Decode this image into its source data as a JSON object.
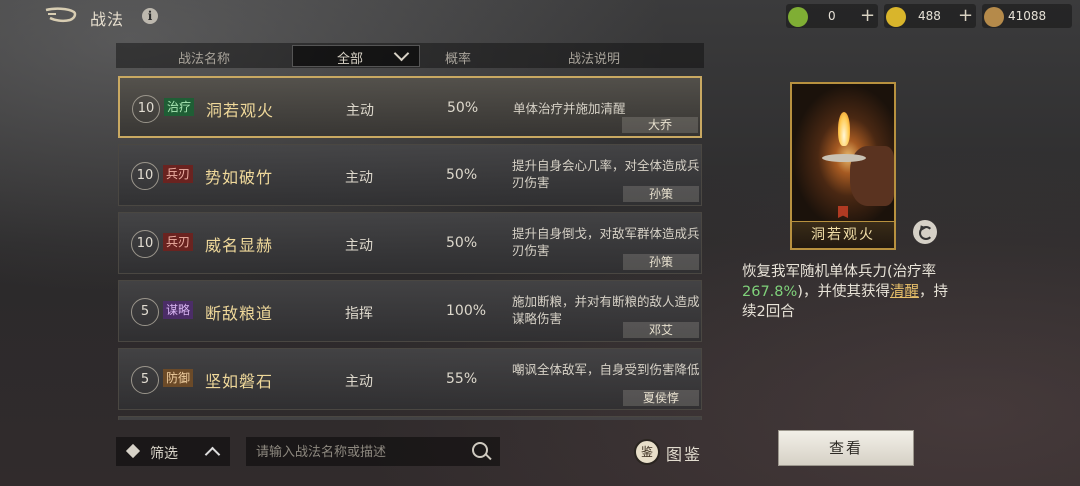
{
  "header": {
    "title": "战法",
    "currencies": [
      {
        "icon": "jade-icon",
        "value": "0",
        "color": "#7fae34"
      },
      {
        "icon": "gold-icon",
        "value": "488",
        "color": "#d9b52b"
      },
      {
        "icon": "copper-coin-icon",
        "value": "41088",
        "color": "#b58a4a"
      }
    ]
  },
  "table": {
    "col_name": "战法名称",
    "filter_value": "全部",
    "col_rate": "概率",
    "col_desc": "战法说明"
  },
  "skills": [
    {
      "level": "10",
      "tag": "治疗",
      "name": "洞若观火",
      "type": "主动",
      "rate": "50%",
      "desc": "单体治疗并施加清醒",
      "owner": "大乔"
    },
    {
      "level": "10",
      "tag": "兵刃",
      "name": "势如破竹",
      "type": "主动",
      "rate": "50%",
      "desc": "提升自身会心几率，对全体造成兵刃伤害",
      "owner": "孙策"
    },
    {
      "level": "10",
      "tag": "兵刃",
      "name": "威名显赫",
      "type": "主动",
      "rate": "50%",
      "desc": "提升自身倒戈，对敌军群体造成兵刃伤害",
      "owner": "孙策"
    },
    {
      "level": "5",
      "tag": "谋略",
      "name": "断敌粮道",
      "type": "指挥",
      "rate": "100%",
      "desc": "施加断粮，并对有断粮的敌人造成谋略伤害",
      "owner": "邓艾"
    },
    {
      "level": "5",
      "tag": "防御",
      "name": "坚如磐石",
      "type": "主动",
      "rate": "55%",
      "desc": "嘲讽全体敌军，自身受到伤害降低",
      "owner": "夏侯惇"
    }
  ],
  "footer": {
    "filter_label": "筛选",
    "search_placeholder": "请输入战法名称或描述",
    "codex_label": "图鉴",
    "codex_icon_char": "鉴"
  },
  "detail": {
    "card_name": "洞若观火",
    "text_1": "恢复我军随机单体兵力(治疗率",
    "rate": "267.8%",
    "text_2": ")，并使其获得",
    "status": "清醒",
    "text_3": "，持续2回合",
    "view_label": "查看"
  }
}
